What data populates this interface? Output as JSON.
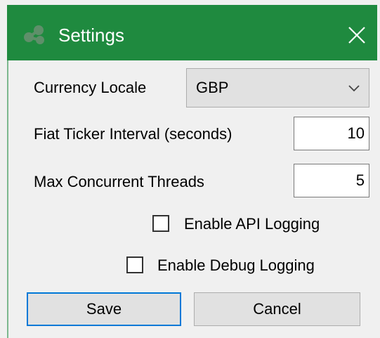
{
  "window": {
    "title": "Settings",
    "accent_color": "#1f8a3f",
    "app_icon": "app-logo-icon",
    "close_icon": "close-icon"
  },
  "form": {
    "currency_locale": {
      "label": "Currency Locale",
      "value": "GBP"
    },
    "fiat_ticker_interval": {
      "label": "Fiat Ticker Interval (seconds)",
      "value": "10"
    },
    "max_concurrent_threads": {
      "label": "Max Concurrent Threads",
      "value": "5"
    },
    "enable_api_logging": {
      "label": "Enable API Logging",
      "checked": false
    },
    "enable_debug_logging": {
      "label": "Enable Debug Logging",
      "checked": false
    }
  },
  "buttons": {
    "save_label": "Save",
    "cancel_label": "Cancel"
  }
}
